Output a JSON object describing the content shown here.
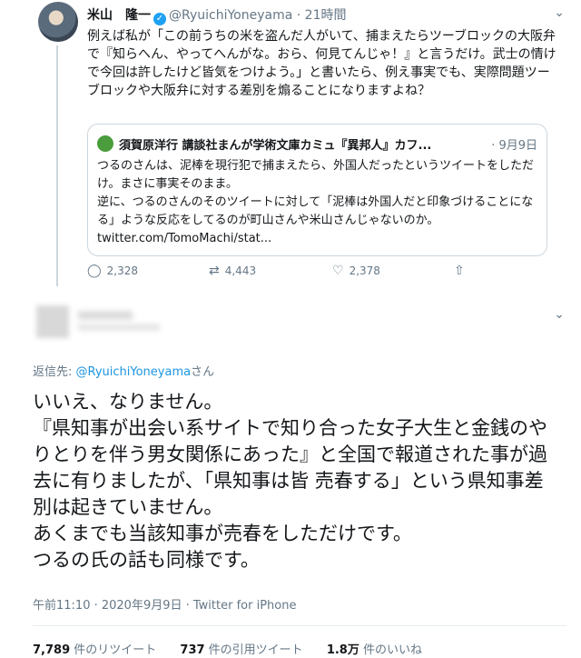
{
  "tweet": {
    "name": "米山　隆一",
    "handle": "@RyuichiYoneyama",
    "dot": "·",
    "time": "21時間",
    "caret": "⌄",
    "text": "例えば私が「この前うちの米を盗んだ人がいて、捕まえたらツーブロックの大阪弁で『知らへん、やってへんがな。おら、何見てんじゃ！』と言うだけ。武士の情けで今回は許したけど皆気をつけよう。」と書いたら、例え事実でも、実際問題ツーブロックや大阪弁に対する差別を煽ることになりますよね？",
    "quote": {
      "name": "須賀原洋行 講談社まんが学術文庫カミュ『異邦人』カフ...",
      "date": "· 9月9日",
      "text": "つるのさんは、泥棒を現行犯で捕まえたら、外国人だったというツイートをしただけ。まさに事実そのまま。\n逆に、つるのさんのそのツイートに対して「泥棒は外国人だと印象づけることになる」ような反応をしてるのが町山さんや米山さんじゃないのか。 twitter.com/TomoMachi/stat..."
    },
    "actions": {
      "reply_icon": "◯",
      "reply_count": "2,328",
      "retweet_icon": "⇄",
      "retweet_count": "4,443",
      "like_icon": "♡",
      "like_count": "2,378",
      "share_icon": "⇧"
    }
  },
  "reply": {
    "caret": "⌄",
    "reply_to_prefix": "返信先: ",
    "reply_to_handle": "@RyuichiYoneyama",
    "reply_to_suffix": "さん",
    "text": "いいえ、なりません。\n『県知事が出会い系サイトで知り合った女子大生と金銭のやりとりを伴う男女関係にあった』と全国で報道された事が過去に有りましたが、「県知事は皆 売春する」という県知事差別は起きていません。\nあくまでも当該知事が売春をしただけです。\nつるの氏の話も同様です。",
    "meta": "午前11:10 · 2020年9月9日 · Twitter for iPhone",
    "stats": {
      "retweets": "7,789",
      "retweets_label": " 件のリツイート",
      "quotes": "737",
      "quotes_label": " 件の引用ツイート",
      "likes": "1.8万",
      "likes_label": " 件のいいね"
    }
  }
}
